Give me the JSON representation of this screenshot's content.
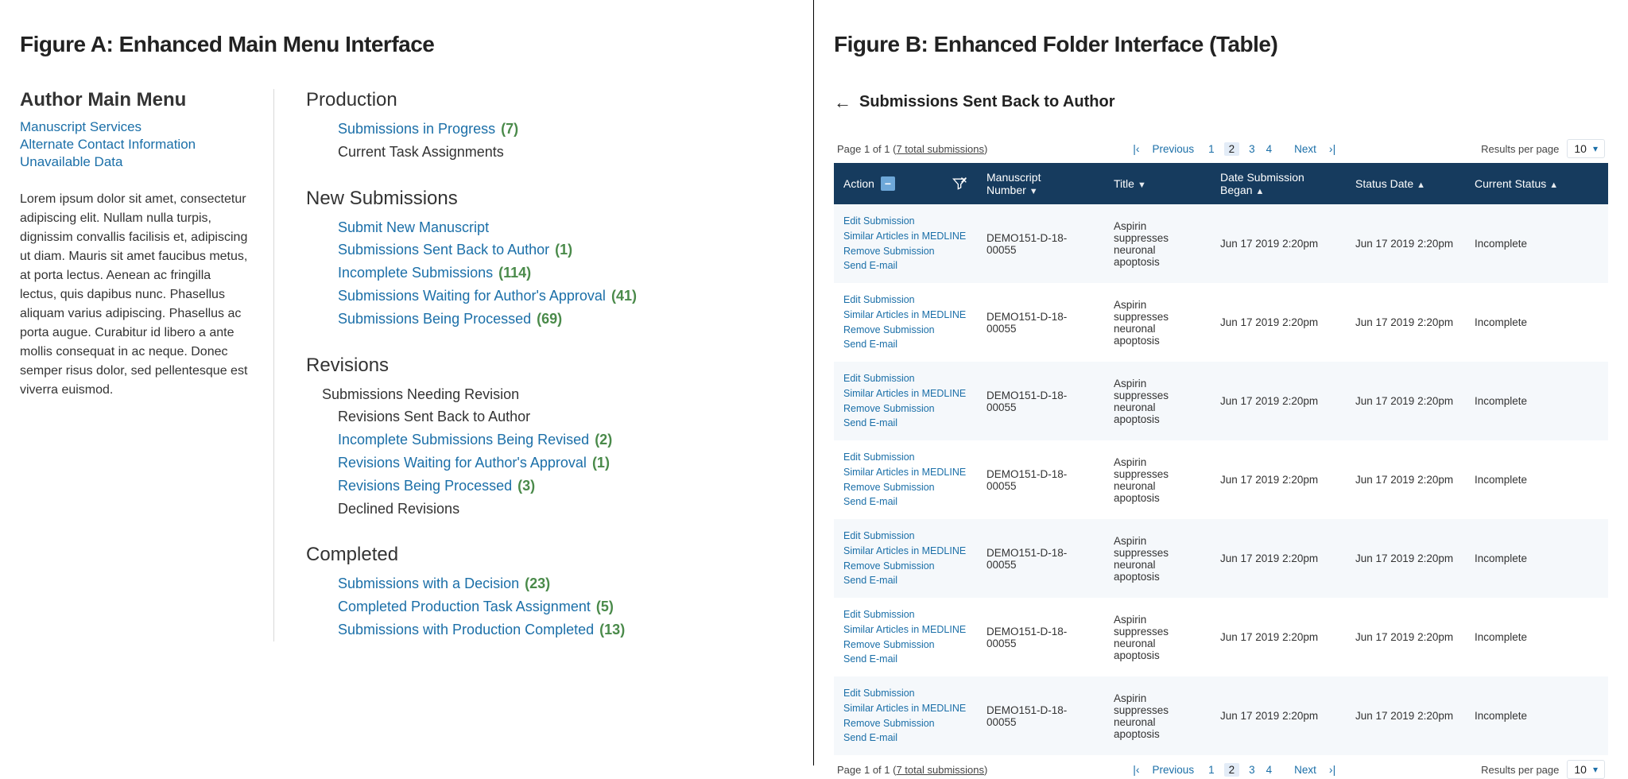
{
  "figureA": {
    "title": "Figure A: Enhanced Main Menu Interface",
    "left": {
      "heading": "Author Main Menu",
      "links": [
        "Manuscript Services",
        "Alternate Contact Information",
        "Unavailable Data"
      ],
      "lorem": "Lorem ipsum dolor sit amet, consectetur adipiscing elit. Nullam nulla turpis, dignissim convallis facilisis et, adipiscing ut diam. Mauris sit amet faucibus metus, at porta lectus. Aenean ac fringilla lectus, quis dapibus nunc. Phasellus aliquam varius adipiscing. Phasellus ac porta augue. Curabitur id libero a ante mollis consequat in ac neque. Donec semper risus dolor, sed pellentesque est viverra euismod."
    },
    "sections": {
      "production": {
        "title": "Production",
        "items": [
          {
            "label": "Submissions in Progress",
            "count": "(7)",
            "link": true
          },
          {
            "label": "Current Task Assignments",
            "count": "",
            "link": false
          }
        ]
      },
      "newSubmissions": {
        "title": "New Submissions",
        "items": [
          {
            "label": "Submit New Manuscript",
            "count": "",
            "link": true
          },
          {
            "label": "Submissions Sent Back to Author",
            "count": "(1)",
            "link": true
          },
          {
            "label": "Incomplete Submissions",
            "count": "(114)",
            "link": true
          },
          {
            "label": "Submissions Waiting for Author's Approval",
            "count": "(41)",
            "link": true
          },
          {
            "label": "Submissions Being Processed",
            "count": "(69)",
            "link": true
          }
        ]
      },
      "revisions": {
        "title": "Revisions",
        "subTitle": "Submissions Needing Revision",
        "items": [
          {
            "label": "Revisions Sent Back to Author",
            "count": "",
            "link": false
          },
          {
            "label": "Incomplete Submissions Being Revised",
            "count": "(2)",
            "link": true
          },
          {
            "label": "Revisions Waiting for Author's Approval",
            "count": "(1)",
            "link": true
          },
          {
            "label": "Revisions Being Processed",
            "count": "(3)",
            "link": true
          },
          {
            "label": "Declined Revisions",
            "count": "",
            "link": false
          }
        ]
      },
      "completed": {
        "title": "Completed",
        "items": [
          {
            "label": "Submissions with a Decision",
            "count": "(23)",
            "link": true
          },
          {
            "label": "Completed Production Task Assignment",
            "count": "(5)",
            "link": true
          },
          {
            "label": "Submissions with Production Completed",
            "count": "(13)",
            "link": true
          }
        ]
      }
    }
  },
  "figureB": {
    "title": "Figure B: Enhanced Folder Interface (Table)",
    "pageHeading": "Submissions Sent Back to Author",
    "pager": {
      "pageOfPrefix": "Page 1 of 1 (",
      "pageOfLink": "7 total submissions",
      "pageOfSuffix": ")",
      "previous": "Previous",
      "next": "Next",
      "pages": [
        "1",
        "2",
        "3",
        "4"
      ],
      "activePage": "2",
      "resultsPerPageLabel": "Results per page",
      "resultsPerPageValue": "10"
    },
    "columns": {
      "action": "Action",
      "mnum": "Manuscript Number",
      "title": "Title",
      "dbegan": "Date Submission Began",
      "sdate": "Status Date",
      "status": "Current Status"
    },
    "rowActionLinks": [
      "Edit Submission",
      "Similar Articles in MEDLINE",
      "Remove Submission",
      "Send E-mail"
    ],
    "rows": [
      {
        "mnum": "DEMO151-D-18-00055",
        "title": "Aspirin suppresses neuronal apoptosis",
        "dbegan": "Jun 17 2019 2:20pm",
        "sdate": "Jun 17 2019 2:20pm",
        "status": "Incomplete"
      },
      {
        "mnum": "DEMO151-D-18-00055",
        "title": "Aspirin suppresses neuronal apoptosis",
        "dbegan": "Jun 17 2019 2:20pm",
        "sdate": "Jun 17 2019 2:20pm",
        "status": "Incomplete"
      },
      {
        "mnum": "DEMO151-D-18-00055",
        "title": "Aspirin suppresses neuronal apoptosis",
        "dbegan": "Jun 17 2019 2:20pm",
        "sdate": "Jun 17 2019 2:20pm",
        "status": "Incomplete"
      },
      {
        "mnum": "DEMO151-D-18-00055",
        "title": "Aspirin suppresses neuronal apoptosis",
        "dbegan": "Jun 17 2019 2:20pm",
        "sdate": "Jun 17 2019 2:20pm",
        "status": "Incomplete"
      },
      {
        "mnum": "DEMO151-D-18-00055",
        "title": "Aspirin suppresses neuronal apoptosis",
        "dbegan": "Jun 17 2019 2:20pm",
        "sdate": "Jun 17 2019 2:20pm",
        "status": "Incomplete"
      },
      {
        "mnum": "DEMO151-D-18-00055",
        "title": "Aspirin suppresses neuronal apoptosis",
        "dbegan": "Jun 17 2019 2:20pm",
        "sdate": "Jun 17 2019 2:20pm",
        "status": "Incomplete"
      },
      {
        "mnum": "DEMO151-D-18-00055",
        "title": "Aspirin suppresses neuronal apoptosis",
        "dbegan": "Jun 17 2019 2:20pm",
        "sdate": "Jun 17 2019 2:20pm",
        "status": "Incomplete"
      }
    ]
  }
}
